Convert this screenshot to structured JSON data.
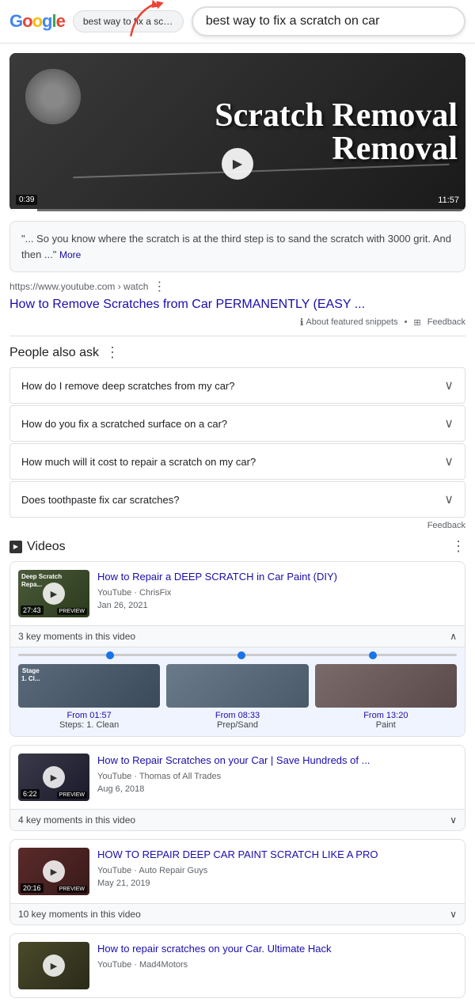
{
  "header": {
    "logo_letters": [
      "G",
      "o",
      "o",
      "g",
      "l",
      "e"
    ],
    "search_small": "best way to fix a scratch on",
    "search_large": "best way to fix a scratch on car"
  },
  "featured_video": {
    "title": "Scratch Removal",
    "time_current": "0:39",
    "time_total": "11:57"
  },
  "featured_snippet": {
    "text": "\"... So you know where the scratch is at the third step is to sand the scratch with 3000 grit. And then ...\"",
    "more_label": "More"
  },
  "result": {
    "url": "https://www.youtube.com › watch",
    "title": "How to Remove Scratches from Car PERMANENTLY (EASY ...",
    "about_label": "About featured snippets",
    "feedback_label": "Feedback"
  },
  "people_also_ask": {
    "section_label": "People also ask",
    "feedback_label": "Feedback",
    "questions": [
      "How do I remove deep scratches from my car?",
      "How do you fix a scratched surface on a car?",
      "How much will it cost to repair a scratch on my car?",
      "Does toothpaste fix car scratches?"
    ]
  },
  "videos_section": {
    "section_label": "Videos",
    "cards": [
      {
        "title": "How to Repair a DEEP SCRATCH in Car Paint (DIY)",
        "channel": "ChrisFix",
        "date": "Jan 26, 2021",
        "duration": "27:43",
        "preview_label": "PREVIEW",
        "thumb_text": "Deep Scratch\nRepa...",
        "key_moments_label": "3 key moments in this video",
        "expanded": true,
        "moments": [
          {
            "time": "From 01:57",
            "label": "Steps: 1. Clean",
            "thumb_text": "Stage\n1. Cl..."
          },
          {
            "time": "From 08:33",
            "label": "Prep/Sand",
            "thumb_text": ""
          },
          {
            "time": "From 13:20",
            "label": "Paint",
            "thumb_text": ""
          }
        ]
      },
      {
        "title": "How to Repair Scratches on your Car | Save Hundreds of ...",
        "channel": "Thomas of All Trades",
        "date": "Aug 6, 2018",
        "duration": "6:22",
        "preview_label": "PREVIEW",
        "thumb_text": "",
        "key_moments_label": "4 key moments in this video",
        "expanded": false,
        "moments": []
      },
      {
        "title": "HOW TO REPAIR DEEP CAR PAINT SCRATCH LIKE A PRO",
        "channel": "Auto Repair Guys",
        "date": "May 21, 2019",
        "duration": "20:16",
        "preview_label": "PREVIEW",
        "thumb_text": "",
        "key_moments_label": "10 key moments in this video",
        "expanded": false,
        "moments": []
      },
      {
        "title": "How to repair scratches on your Car. Ultimate Hack",
        "channel": "Mad4Motors",
        "date": "",
        "duration": "",
        "preview_label": "",
        "thumb_text": "",
        "key_moments_label": "",
        "expanded": false,
        "moments": []
      }
    ]
  }
}
